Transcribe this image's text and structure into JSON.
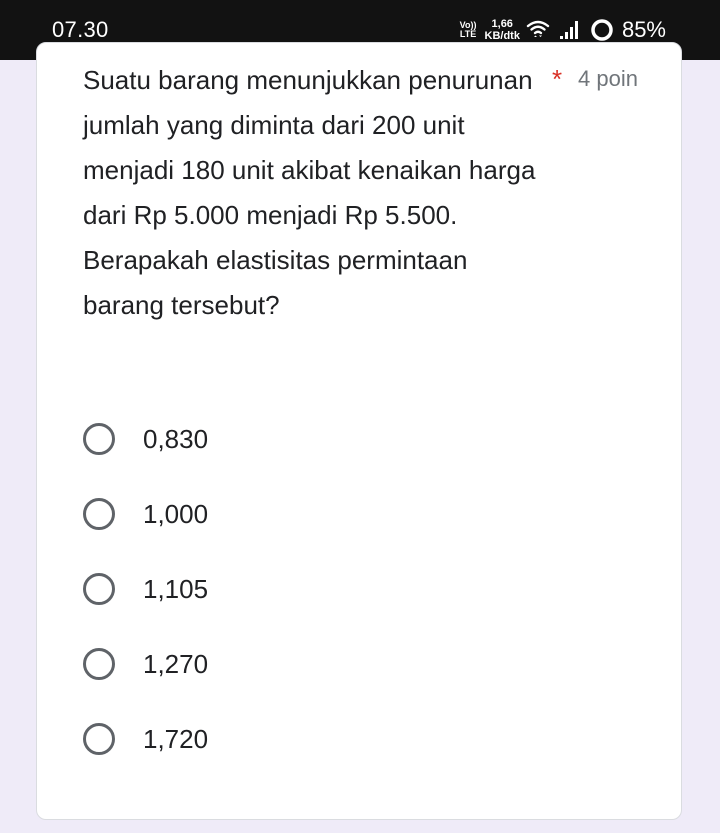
{
  "status_bar": {
    "time": "07.30",
    "volte_top": "Vo))",
    "volte_bottom": "LTE",
    "speed_value": "1,66",
    "speed_unit": "KB/dtk",
    "battery": "85%"
  },
  "question": {
    "text": "Suatu barang menunjukkan penurunan jumlah yang diminta dari 200 unit menjadi 180 unit akibat kenaikan harga dari Rp 5.000 menjadi Rp 5.500. Berapakah elastisitas permintaan barang tersebut?",
    "required_marker": "*",
    "points": "4 poin"
  },
  "options": [
    {
      "label": "0,830"
    },
    {
      "label": "1,000"
    },
    {
      "label": "1,105"
    },
    {
      "label": "1,270"
    },
    {
      "label": "1,720"
    }
  ],
  "colors": {
    "background": "#efebf8",
    "status_bar": "#121212",
    "required": "#d93025",
    "radio_border": "#5f6368"
  },
  "icons": [
    "volte-icon",
    "wifi-icon",
    "signal-icon",
    "battery-ring-icon",
    "radio-icon"
  ]
}
